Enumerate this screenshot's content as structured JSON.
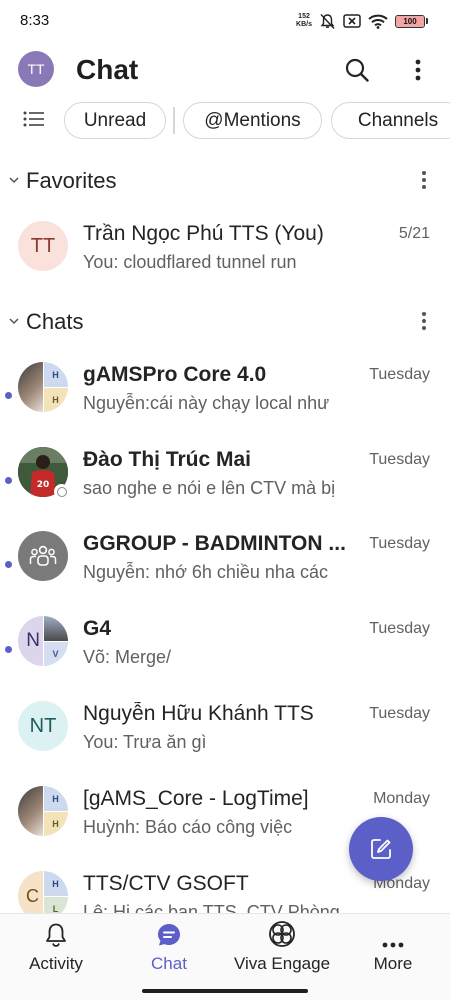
{
  "status_bar": {
    "time": "8:33",
    "net_speed_top": "152",
    "net_speed_bottom": "KB/s",
    "battery_level": "100"
  },
  "header": {
    "avatar_initials": "TT",
    "title": "Chat"
  },
  "filters": {
    "unread": "Unread",
    "mentions": "@Mentions",
    "channels": "Channels"
  },
  "favorites": {
    "title": "Favorites",
    "items": [
      {
        "initials": "TT",
        "name": "Trần Ngọc Phú TTS (You)",
        "preview": "You: cloudflared tunnel run",
        "time": "5/21"
      }
    ]
  },
  "chats": {
    "title": "Chats",
    "items": [
      {
        "name": "gAMSPro Core 4.0",
        "preview": "Nguyễn:cái này chạy local như",
        "time": "Tuesday",
        "unread": true,
        "avatar_tr": "H",
        "avatar_br": "H"
      },
      {
        "name": "Đào Thị Trúc Mai",
        "preview": "sao nghe e nói e lên CTV mà bị",
        "time": "Tuesday",
        "unread": true,
        "jersey": "20"
      },
      {
        "name": "GGROUP - BADMINTON ...",
        "preview": "Nguyễn: nhớ 6h chiều nha các",
        "time": "Tuesday",
        "unread": true
      },
      {
        "name": "G4",
        "preview": "Võ: Merge/",
        "time": "Tuesday",
        "unread": true,
        "avatar_left": "N",
        "avatar_br": "V"
      },
      {
        "initials": "NT",
        "name": "Nguyễn Hữu Khánh TTS",
        "preview": "You: Trưa ăn gì",
        "time": "Tuesday",
        "unread": false
      },
      {
        "name": "[gAMS_Core - LogTime]",
        "preview": "Huỳnh: Báo cáo công việc",
        "time": "Monday",
        "unread": false,
        "avatar_tr": "H",
        "avatar_br": "H"
      },
      {
        "name": "TTS/CTV GSOFT",
        "preview": "Lê: Hi các bạn TTS, CTV Phòng",
        "time": "Monday",
        "unread": false,
        "avatar_left": "C",
        "avatar_tr": "H",
        "avatar_br": "L"
      }
    ]
  },
  "nav": {
    "activity": "Activity",
    "chat": "Chat",
    "viva": "Viva Engage",
    "more": "More"
  },
  "colors": {
    "brand": "#5b5fc7",
    "unread_dot": "#5b5fc7",
    "me_avatar": "#8a79b7"
  },
  "icons": [
    "search-icon",
    "more-vertical-icon",
    "filter-list-icon",
    "chevron-down-icon",
    "compose-icon",
    "bell-icon",
    "chat-bubble-icon",
    "viva-engage-icon",
    "more-horizontal-icon",
    "group-people-icon"
  ]
}
